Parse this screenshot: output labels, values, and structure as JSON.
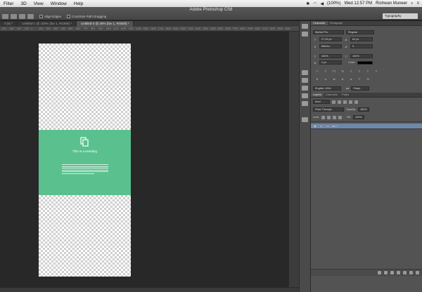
{
  "menubar": {
    "items": [
      "Filter",
      "3D",
      "View",
      "Window",
      "Help"
    ],
    "status": "Wed 12:57 PM",
    "user": "Rishwan Muneer",
    "battery": "(100%)"
  },
  "window": {
    "title": "Adobe Photoshop CS6"
  },
  "options_bar": {
    "align_edges": "Align Edges",
    "constrain": "Constrain Path Dragging",
    "workspace": "Typography"
  },
  "tabs": [
    {
      "label": "rl (8) *"
    },
    {
      "label": "Untitled-1 @ 100% (fav 1, RGB/8) *"
    },
    {
      "label": "Untitled-3 @ 25% (fav 1, RGB/8) *"
    }
  ],
  "ruler": {
    "ticks": [
      "-400",
      "-300",
      "-200",
      "-100",
      "0",
      "100",
      "200",
      "300",
      "400",
      "500",
      "600",
      "700",
      "800",
      "900",
      "1000",
      "1100",
      "1200",
      "1300",
      "1400",
      "1500",
      "1600",
      "1700",
      "1800",
      "1900",
      "2000",
      "2100",
      "2200",
      "2300",
      "2400",
      "2500",
      "2600",
      "2700",
      "2800",
      "2900",
      "3000",
      "3100",
      "3200",
      "3300",
      "3400"
    ]
  },
  "artboard": {
    "heading": "This is a Heading",
    "accent": "#5ac18e"
  },
  "character_panel": {
    "tab_character": "Character",
    "tab_paragraph": "Paragraph",
    "font_family": "Myriad Pro",
    "font_style": "Regular",
    "size": "27.25 px",
    "leading": "62 px",
    "kerning": "Metrics",
    "tracking": "0",
    "vscale": "100%",
    "hscale": "100%",
    "baseline": "0 px",
    "color_label": "Color:",
    "language": "English: USA",
    "aa": "Sharp"
  },
  "layers_panel": {
    "tab_layers": "Layers",
    "tab_channels": "Channels",
    "tab_paths": "Paths",
    "kind": "Kind",
    "blend": "Pass Through",
    "opacity_label": "Opacity:",
    "opacity": "100%",
    "lock_label": "Lock:",
    "fill_label": "Fill:",
    "fill": "100%",
    "layer_name": "fav 1"
  }
}
